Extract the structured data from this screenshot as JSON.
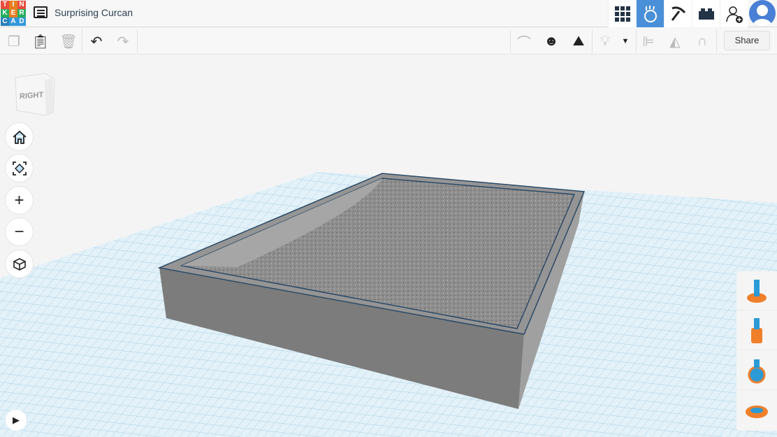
{
  "app": {
    "logo_letters": [
      "T",
      "I",
      "N",
      "K",
      "E",
      "R",
      "C",
      "A",
      "D"
    ],
    "logo_colors": [
      "#e74c3c",
      "#e67e22",
      "#e74c3c",
      "#27ae60",
      "#e67e22",
      "#27ae60",
      "#2980b9",
      "#3498db",
      "#3498db"
    ],
    "title": "Surprising Curcan"
  },
  "header": {
    "buttons": [
      "grid-view",
      "tinker-3d",
      "minecraft",
      "lego",
      "invite-user",
      "profile"
    ],
    "accent": "#4a90d9"
  },
  "toolbar": {
    "share_label": "Share"
  },
  "viewcube": {
    "face_label": "RIGHT"
  },
  "shapes_panel": {
    "items": [
      "cylinder-shape",
      "bottle-shape",
      "onion-shape",
      "ring-shape"
    ]
  }
}
